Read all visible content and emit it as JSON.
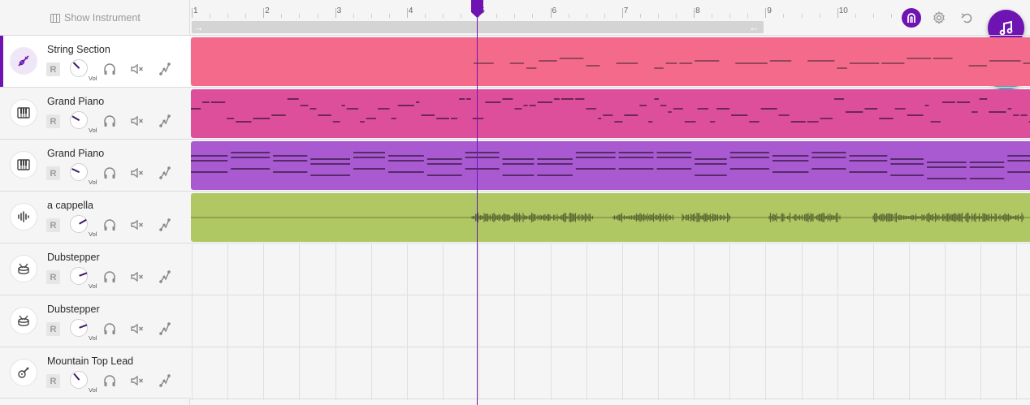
{
  "header": {
    "show_instrument": "Show Instrument"
  },
  "ruler": {
    "bars": [
      "1",
      "2",
      "3",
      "4",
      "5",
      "6",
      "7",
      "8",
      "9",
      "10"
    ]
  },
  "colors": {
    "accent": "#6f14b3",
    "string_section": "#f46a8b",
    "grand_piano_1": "#dd4f9b",
    "grand_piano_2": "#a95ad0",
    "a_cappella": "#b0c863",
    "collab": "#5aa0b8"
  },
  "tracks": [
    {
      "name": "String Section",
      "icon": "violin-icon",
      "rec": "R",
      "vol_label": "Vol",
      "selected": true
    },
    {
      "name": "Grand Piano",
      "icon": "piano-icon",
      "rec": "R",
      "vol_label": "Vol"
    },
    {
      "name": "Grand Piano",
      "icon": "piano-icon",
      "rec": "R",
      "vol_label": "Vol"
    },
    {
      "name": "a cappella",
      "icon": "waveform-icon",
      "rec": "R",
      "vol_label": "Vol"
    },
    {
      "name": "Dubstepper",
      "icon": "drum-icon",
      "rec": "R",
      "vol_label": "Vol"
    },
    {
      "name": "Dubstepper",
      "icon": "drum-icon",
      "rec": "R",
      "vol_label": "Vol"
    },
    {
      "name": "Mountain Top Lead",
      "icon": "guitar-icon",
      "rec": "R",
      "vol_label": "Vol"
    }
  ],
  "icons": {
    "metronome": "metronome-icon",
    "settings": "gear-icon",
    "undo": "undo-icon",
    "music": "music-note-icon",
    "collab": "collaborators-icon",
    "loop_start": "arrow-right-icon",
    "loop_end": "arrow-left-icon"
  }
}
